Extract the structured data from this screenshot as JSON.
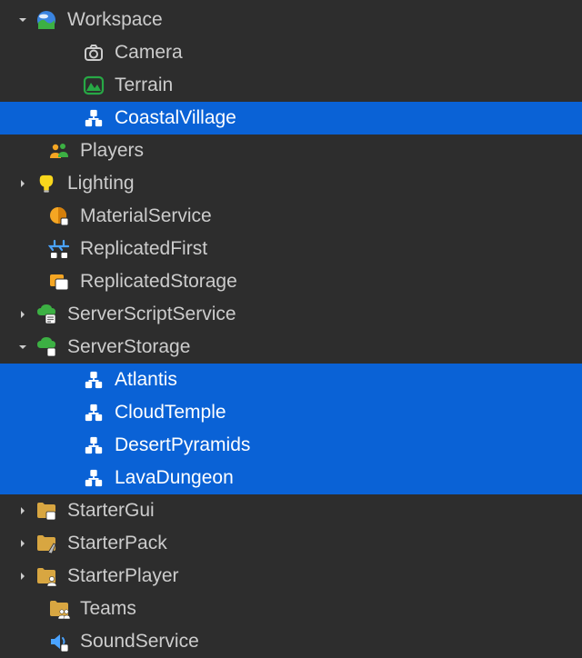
{
  "colors": {
    "bg": "#2d2d2d",
    "fg": "#cccccc",
    "selected_bg": "#0a62d6",
    "selected_fg": "#ffffff"
  },
  "tree": {
    "workspace": {
      "label": "Workspace",
      "expanded": true,
      "children": {
        "camera": {
          "label": "Camera"
        },
        "terrain": {
          "label": "Terrain"
        },
        "coastal_village": {
          "label": "CoastalVillage",
          "selected": true
        }
      }
    },
    "players": {
      "label": "Players"
    },
    "lighting": {
      "label": "Lighting",
      "expandable": true
    },
    "material_service": {
      "label": "MaterialService"
    },
    "replicated_first": {
      "label": "ReplicatedFirst"
    },
    "replicated_storage": {
      "label": "ReplicatedStorage"
    },
    "server_script_service": {
      "label": "ServerScriptService",
      "expandable": true
    },
    "server_storage": {
      "label": "ServerStorage",
      "expanded": true,
      "children": {
        "atlantis": {
          "label": "Atlantis",
          "selected": true
        },
        "cloud_temple": {
          "label": "CloudTemple",
          "selected": true
        },
        "desert_pyramids": {
          "label": "DesertPyramids",
          "selected": true
        },
        "lava_dungeon": {
          "label": "LavaDungeon",
          "selected": true
        }
      }
    },
    "starter_gui": {
      "label": "StarterGui",
      "expandable": true
    },
    "starter_pack": {
      "label": "StarterPack",
      "expandable": true
    },
    "starter_player": {
      "label": "StarterPlayer",
      "expandable": true
    },
    "teams": {
      "label": "Teams"
    },
    "sound_service": {
      "label": "SoundService"
    }
  }
}
